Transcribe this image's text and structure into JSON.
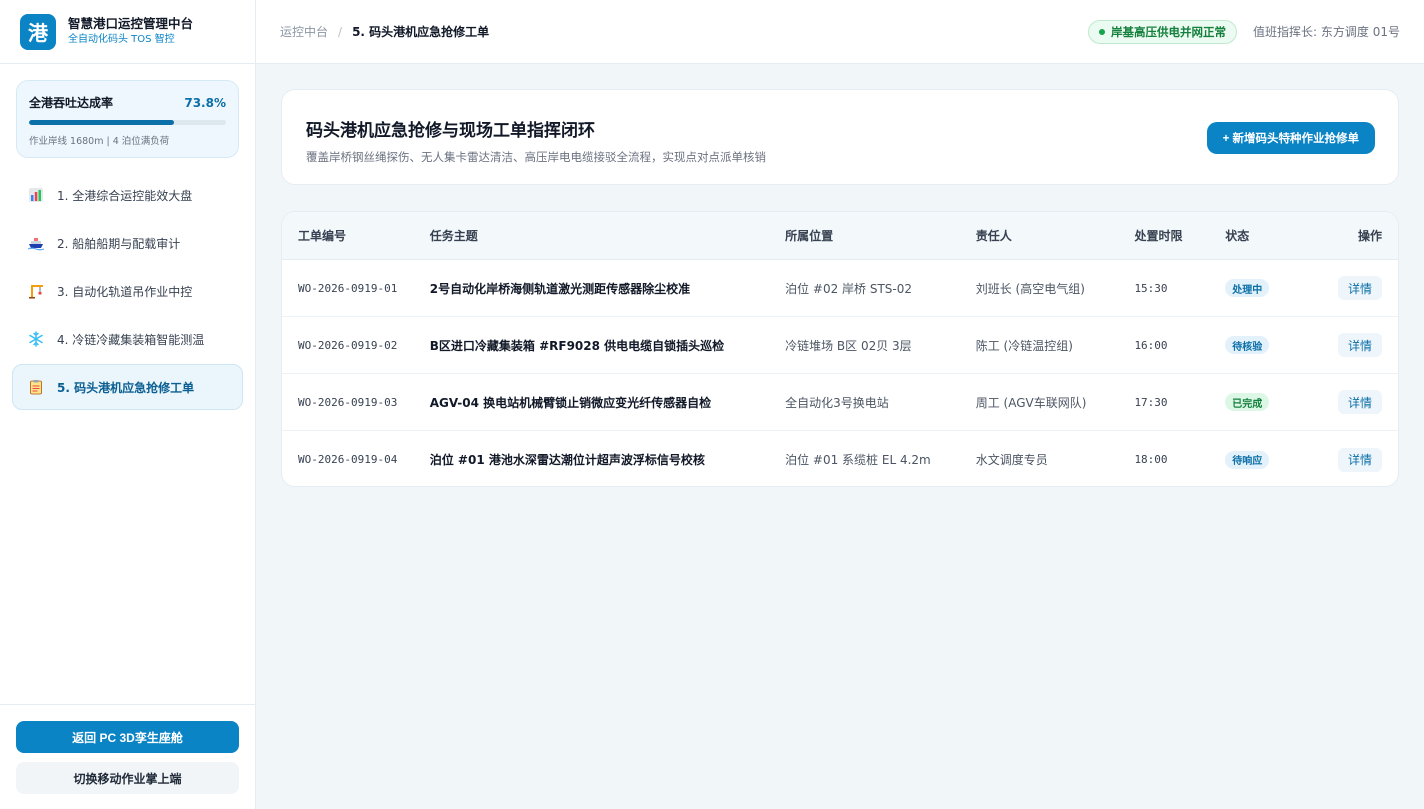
{
  "brand": {
    "logo_char": "港",
    "title": "智慧港口运控管理中台",
    "subtitle": "全自动化码头 TOS 智控"
  },
  "kpi": {
    "label": "全港吞吐达成率",
    "value": "73.8%",
    "progress": 0.738,
    "note": "作业岸线 1680m | 4 泊位满负荷"
  },
  "nav": [
    {
      "icon": "chart-icon",
      "label": "1. 全港综合运控能效大盘",
      "active": false
    },
    {
      "icon": "ship-icon",
      "label": "2. 船舶船期与配载审计",
      "active": false
    },
    {
      "icon": "crane-icon",
      "label": "3. 自动化轨道吊作业中控",
      "active": false
    },
    {
      "icon": "snowflake-icon",
      "label": "4. 冷链冷藏集装箱智能测温",
      "active": false
    },
    {
      "icon": "clipboard-icon",
      "label": "5. 码头港机应急抢修工单",
      "active": true
    }
  ],
  "footer": {
    "primary": "返回 PC 3D孪生座舱",
    "secondary": "切换移动作业掌上端"
  },
  "header": {
    "crumb_root": "运控中台",
    "crumb_sep": "/",
    "crumb_current": "5. 码头港机应急抢修工单",
    "status": "岸基高压供电并网正常",
    "duty": "值班指挥长: 东方调度 01号"
  },
  "hero": {
    "title": "码头港机应急抢修与现场工单指挥闭环",
    "subtitle": "覆盖岸桥钢丝绳探伤、无人集卡雷达清洁、高压岸电电缆接驳全流程，实现点对点派单核销",
    "button": "+ 新增码头特种作业抢修单"
  },
  "table": {
    "headers": [
      "工单编号",
      "任务主题",
      "所属位置",
      "责任人",
      "处置时限",
      "状态",
      "操作"
    ],
    "rows": [
      {
        "id": "WO-2026-0919-01",
        "topic": "2号自动化岸桥海侧轨道激光测距传感器除尘校准",
        "location": "泊位 #02 岸桥 STS-02",
        "owner": "刘班长 (高空电气组)",
        "deadline": "15:30",
        "status": "处理中",
        "action": "详情"
      },
      {
        "id": "WO-2026-0919-02",
        "topic": "B区进口冷藏集装箱 #RF9028 供电电缆自锁插头巡检",
        "location": "冷链堆场 B区 02贝 3层",
        "owner": "陈工 (冷链温控组)",
        "deadline": "16:00",
        "status": "待核验",
        "action": "详情"
      },
      {
        "id": "WO-2026-0919-03",
        "topic": "AGV-04 换电站机械臂锁止销微应变光纤传感器自检",
        "location": "全自动化3号换电站",
        "owner": "周工 (AGV车联网队)",
        "deadline": "17:30",
        "status": "已完成",
        "action": "详情"
      },
      {
        "id": "WO-2026-0919-04",
        "topic": "泊位 #01 港池水深雷达潮位计超声波浮标信号校核",
        "location": "泊位 #01 系缆桩 EL 4.2m",
        "owner": "水文调度专员",
        "deadline": "18:00",
        "status": "待响应",
        "action": "详情"
      }
    ]
  },
  "colors": {
    "accent": "#0b84c6",
    "status_processing_bg": "#e3f1fb",
    "status_processing_fg": "#0b6fa8",
    "status_verify_bg": "#e3f1fb",
    "status_verify_fg": "#0b6fa8",
    "status_done_bg": "#dcf7e6",
    "status_done_fg": "#15803d",
    "status_pending_bg": "#e3f1fb",
    "status_pending_fg": "#0b6fa8"
  }
}
